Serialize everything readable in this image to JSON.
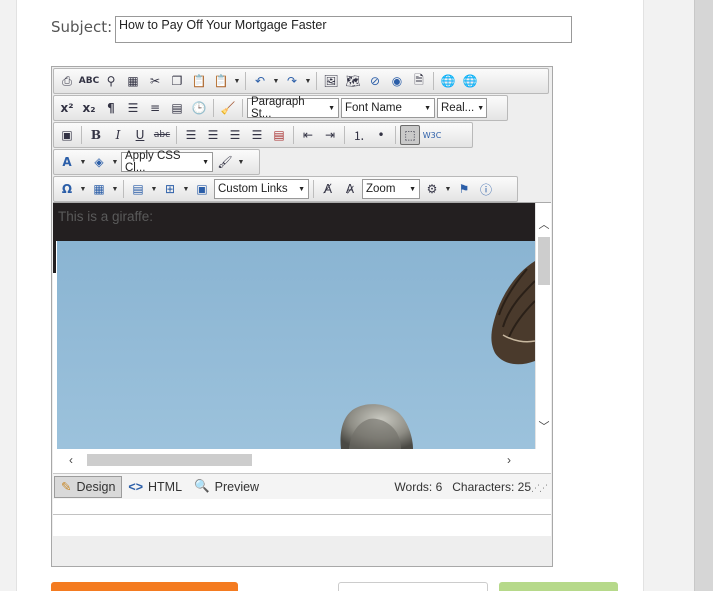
{
  "subject": {
    "label": "Subject:",
    "value": "How to Pay Off Your Mortgage Faster"
  },
  "toolbar": {
    "paragraph_style": "Paragraph St...",
    "font_name": "Font Name",
    "font_size": "Real...",
    "css_class": "Apply CSS Cl...",
    "custom_links": "Custom Links",
    "zoom": "Zoom"
  },
  "content": {
    "caption": "This is a giraffe:"
  },
  "modes": {
    "design": "Design",
    "html": "HTML",
    "preview": "Preview"
  },
  "stats": {
    "words_label": "Words:",
    "words": "6",
    "chars_label": "Characters:",
    "chars": "25"
  },
  "icons": [
    "print-icon",
    "spellcheck-icon",
    "find-icon",
    "select-all-icon",
    "cut-icon",
    "copy-icon",
    "paste-icon",
    "paste-options-icon",
    "undo-icon",
    "redo-icon",
    "image-icon",
    "image-map-icon",
    "flash-icon",
    "media-icon",
    "template-icon",
    "hyperlink-icon",
    "remove-link-icon",
    "superscript-icon",
    "subscript-icon",
    "paragraph-icon",
    "new-paragraph-icon",
    "align-icon",
    "form-icon",
    "date-icon",
    "clean-icon",
    "image-properties-icon",
    "bold-icon",
    "italic-icon",
    "underline-icon",
    "strikethrough-icon",
    "align-left-icon",
    "align-center-icon",
    "align-right-icon",
    "justify-icon",
    "horizontal-rule-icon",
    "outdent-icon",
    "indent-icon",
    "numbered-list-icon",
    "bullet-list-icon",
    "toggle-border-icon",
    "w3c-icon",
    "forecolor-icon",
    "backcolor-icon",
    "format-brush-icon",
    "symbol-icon",
    "table-icon",
    "insert-row-icon",
    "cell-icon",
    "element-icon",
    "case-upper-icon",
    "case-lower-icon",
    "module-icon",
    "track-changes-icon",
    "about-icon",
    "pencil-icon",
    "code-icon",
    "magnifier-icon"
  ]
}
